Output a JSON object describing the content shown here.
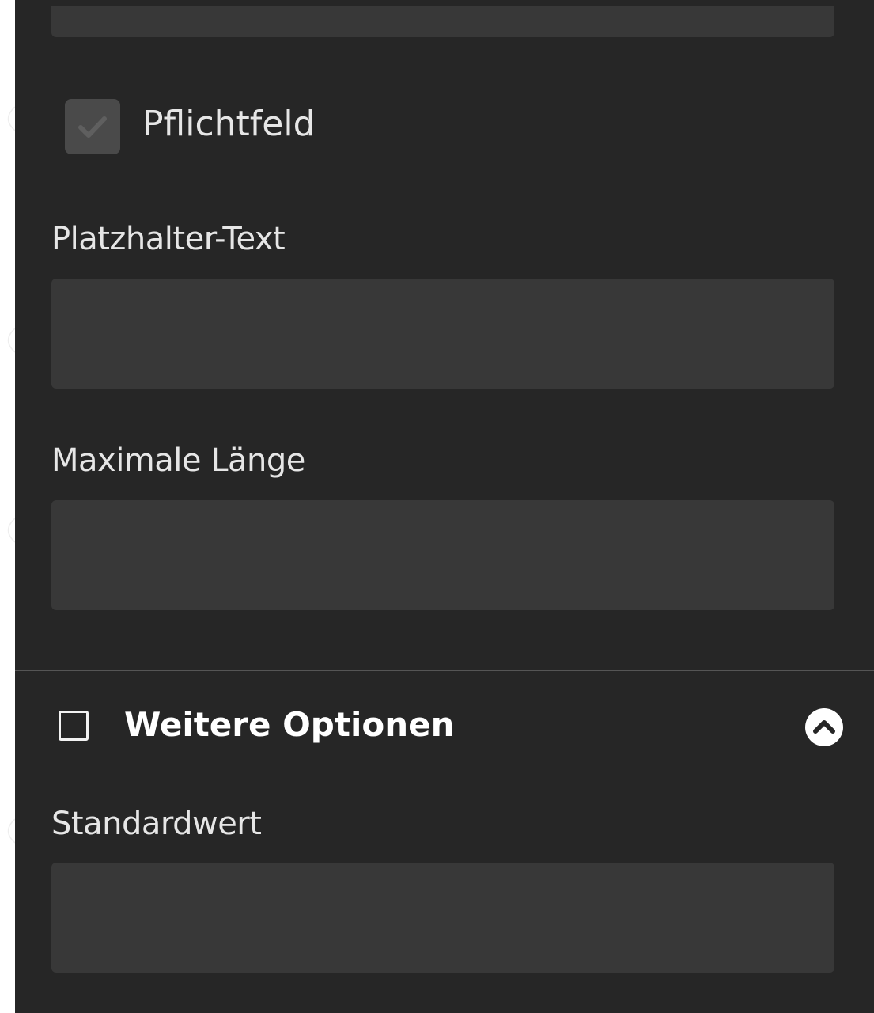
{
  "form": {
    "top_field_value": "",
    "required": {
      "label": "Pflichtfeld",
      "checked": true
    },
    "placeholder_text": {
      "label": "Platzhalter-Text",
      "value": ""
    },
    "max_length": {
      "label": "Maximale Länge",
      "value": ""
    }
  },
  "more_options": {
    "title": "Weitere Optionen",
    "checked": false,
    "expanded": true,
    "toggle_icon": "chevron-up-circle-icon",
    "default_value": {
      "label": "Standardwert",
      "value": ""
    }
  },
  "colors": {
    "panel_bg": "#262626",
    "field_bg": "#383838",
    "text": "#e6e6e6",
    "divider": "#555555"
  }
}
